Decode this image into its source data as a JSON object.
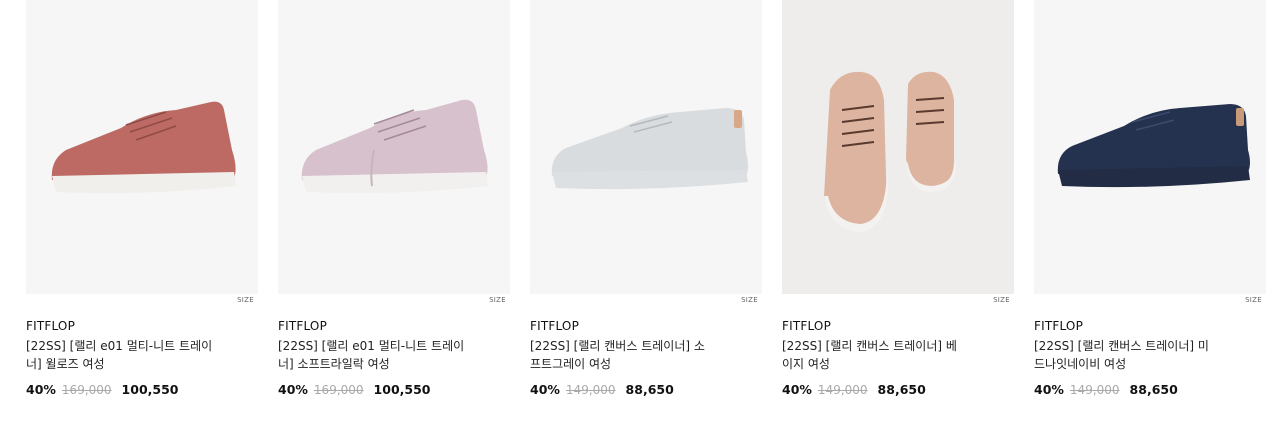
{
  "products": [
    {
      "brand": "FITFLOP",
      "title_line1": "[22SS] [랠리 e01 멀티-니트 트레이",
      "title_line2": "너] 윌로즈 여성",
      "size_label": "SIZE",
      "discount": "40%",
      "original_price": "169,000",
      "final_price": "100,550",
      "shoe_color": "#bd6a64",
      "sole_color": "#f1efec",
      "image_bg": "#f6f6f6"
    },
    {
      "brand": "FITFLOP",
      "title_line1": "[22SS] [랠리 e01 멀티-니트 트레이",
      "title_line2": "너] 소프트라일락 여성",
      "size_label": "SIZE",
      "discount": "40%",
      "original_price": "169,000",
      "final_price": "100,550",
      "shoe_color": "#d7c1cc",
      "sole_color": "#f2f0ee",
      "image_bg": "#f6f6f6"
    },
    {
      "brand": "FITFLOP",
      "title_line1": "[22SS] [랠리 캔버스 트레이너] 소",
      "title_line2": "프트그레이 여성",
      "size_label": "SIZE",
      "discount": "40%",
      "original_price": "149,000",
      "final_price": "88,650",
      "shoe_color": "#d9dcdf",
      "sole_color": "#dde0e3",
      "image_bg": "#f6f6f6"
    },
    {
      "brand": "FITFLOP",
      "title_line1": "[22SS] [랠리 캔버스 트레이너] 베",
      "title_line2": "이지 여성",
      "size_label": "SIZE",
      "discount": "40%",
      "original_price": "149,000",
      "final_price": "88,650",
      "shoe_color": "#ddb4a0",
      "sole_color": "#f4f2f0",
      "image_bg": "#efedeb"
    },
    {
      "brand": "FITFLOP",
      "title_line1": "[22SS] [랠리 캔버스 트레이너] 미",
      "title_line2": "드나잇네이비 여성",
      "size_label": "SIZE",
      "discount": "40%",
      "original_price": "149,000",
      "final_price": "88,650",
      "shoe_color": "#25324f",
      "sole_color": "#222d45",
      "image_bg": "#f6f6f6"
    }
  ]
}
